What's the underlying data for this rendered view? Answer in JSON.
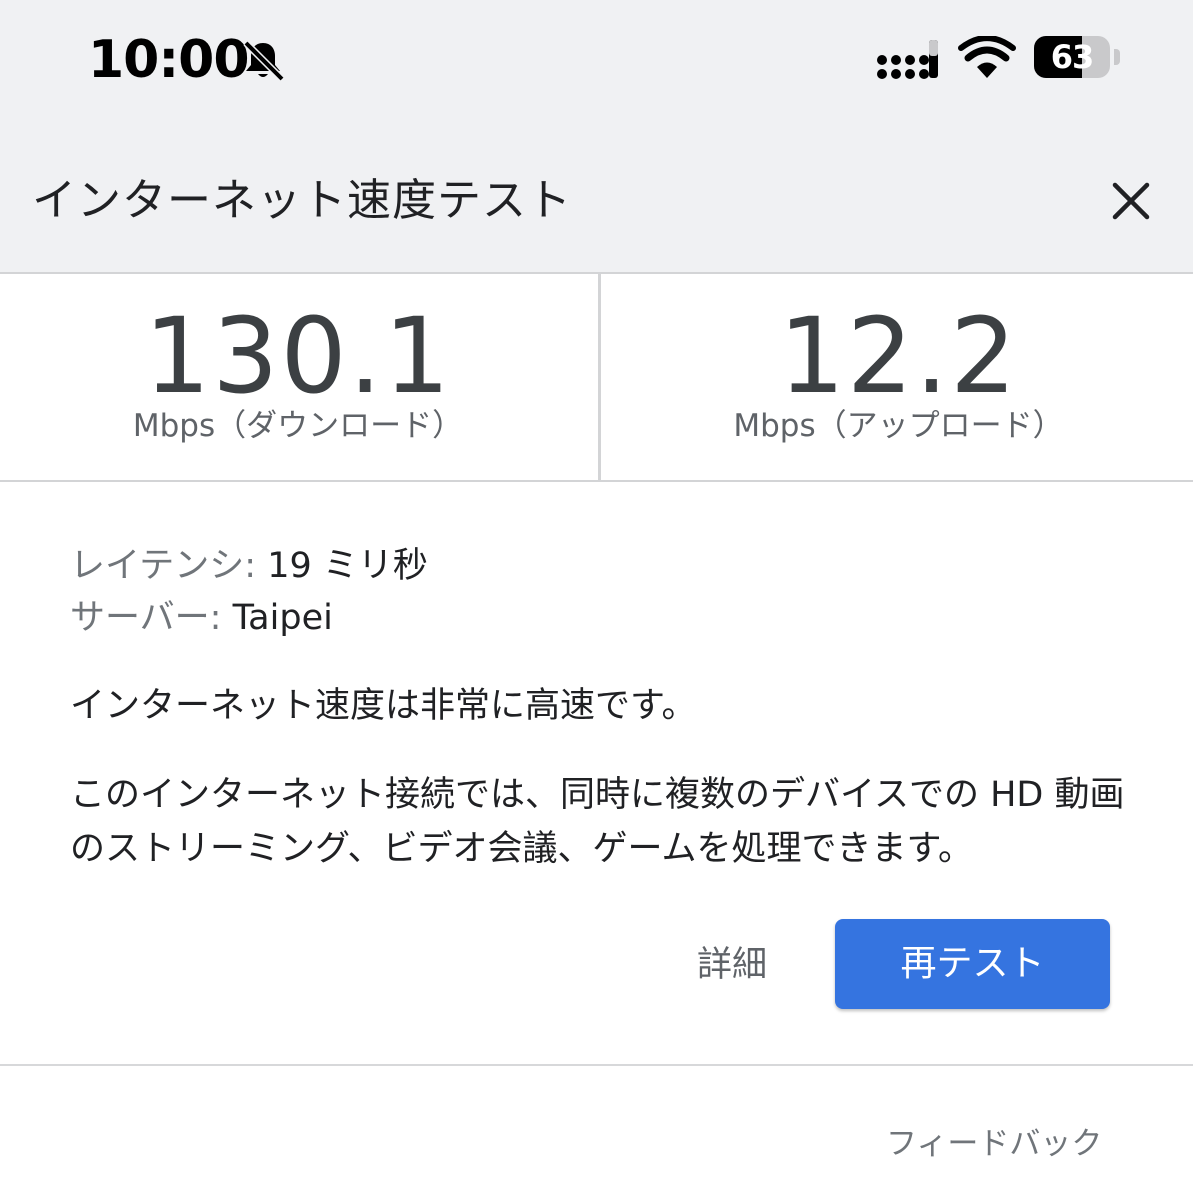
{
  "status_bar": {
    "time": "10:00",
    "battery_percent": "63",
    "battery_level": 0.63,
    "icons": [
      "bell-slash-icon",
      "signal-icon",
      "wifi-icon",
      "battery-icon"
    ]
  },
  "header": {
    "title": "インターネット速度テスト",
    "close_icon": "close-icon"
  },
  "download": {
    "value": "130.1",
    "unit_label": "Mbps（ダウンロード）"
  },
  "upload": {
    "value": "12.2",
    "unit_label": "Mbps（アップロード）"
  },
  "latency": {
    "label": "レイテンシ:",
    "value": "19 ミリ秒"
  },
  "server": {
    "label": "サーバー:",
    "value": "Taipei"
  },
  "summary": "インターネット速度は非常に高速です。",
  "detail": "このインターネット接続では、同時に複数のデバイスでの HD 動画のストリーミング、ビデオ会議、ゲームを処理できます。",
  "actions": {
    "details_label": "詳細",
    "retest_label": "再テスト"
  },
  "feedback": "フィードバック",
  "colors": {
    "accent": "#3574e0",
    "header_bg": "#f0f1f3"
  }
}
